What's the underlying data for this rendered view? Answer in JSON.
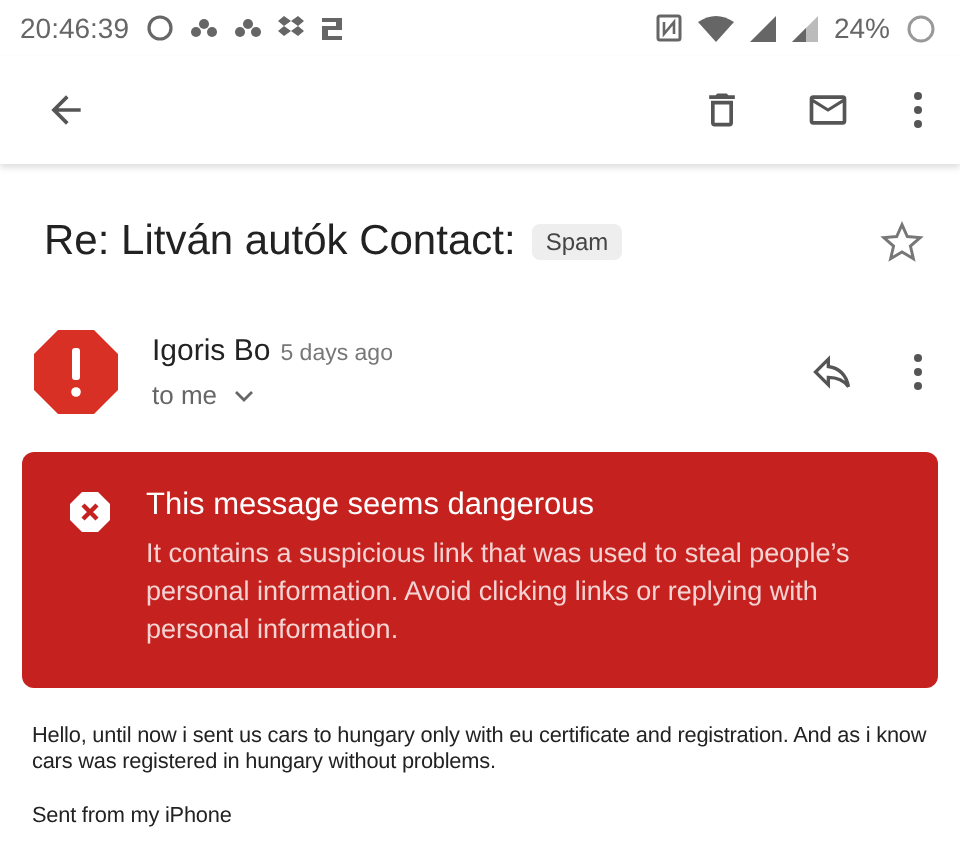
{
  "status_bar": {
    "time": "20:46:39",
    "battery": "24%"
  },
  "message": {
    "subject": "Re: Litván autók Contact:",
    "label": "Spam",
    "starred": false,
    "sender": "Igoris Bo",
    "date": "5 days ago",
    "recipient": "to me"
  },
  "warning": {
    "title": "This message seems dangerous",
    "text": "It contains a suspicious link that was used to steal people’s personal information. Avoid clicking links or replying with personal information."
  },
  "body": [
    "Hello, until now i sent us cars to hungary only with eu certificate and registration. And as i know cars was registered in hungary without problems.",
    "Sent from my iPhone"
  ]
}
